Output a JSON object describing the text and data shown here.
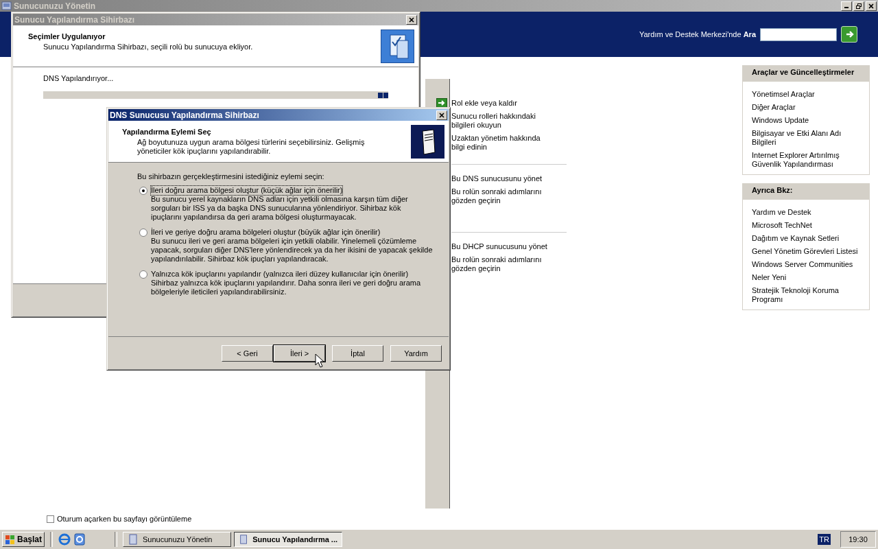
{
  "main_window": {
    "title": "Sunucunuzu Yönetin",
    "active": false,
    "search": {
      "label": "Yardım ve Destek Merkezi'nde **Ara**"
    },
    "role_groups": [
      {
        "links": [
          {
            "text": "Rol ekle veya kaldır",
            "kind": "arrow"
          },
          {
            "text": "Sunucu rolleri hakkındaki bilgileri okuyun",
            "kind": "plain"
          },
          {
            "text": "Uzaktan yönetim hakkında bilgi edinin",
            "kind": "plain"
          }
        ]
      },
      {
        "links": [
          {
            "text": "Bu DNS sunucusunu yönet",
            "kind": "plain"
          },
          {
            "text": "Bu rolün sonraki adımlarını gözden geçirin",
            "kind": "plain"
          }
        ]
      },
      {
        "links": [
          {
            "text": "Bu DHCP sunucusunu yönet",
            "kind": "plain"
          },
          {
            "text": "Bu rolün sonraki adımlarını gözden geçirin",
            "kind": "plain"
          }
        ]
      }
    ],
    "sidebar": [
      {
        "title": "Araçlar ve Güncelleştirmeler",
        "items": [
          "Yönetimsel Araçlar",
          "Diğer Araçlar",
          "Windows Update",
          "Bilgisayar ve Etki Alanı Adı Bilgileri",
          "Internet Explorer Artırılmış Güvenlik Yapılandırması"
        ]
      },
      {
        "title": "Ayrıca Bkz:",
        "items": [
          "Yardım ve Destek",
          "Microsoft TechNet",
          "Dağıtım ve Kaynak Setleri",
          "Genel Yönetim Görevleri Listesi",
          "Windows Server Communities",
          "Neler Yeni",
          "Stratejik Teknoloji Koruma Programı"
        ]
      }
    ],
    "footer_checkbox": {
      "label": "Oturum açarken bu sayfayı görüntüleme",
      "checked": false
    }
  },
  "setup_wizard": {
    "title": "Sunucu Yapılandırma Sihirbazı",
    "active": false,
    "heading": "Seçimler Uygulanıyor",
    "subheading": "Sunucu Yapılandırma Sihirbazı, seçili rolü bu sunucuya ekliyor.",
    "status": "DNS Yapılandırıyor..."
  },
  "dns_wizard": {
    "title": "DNS Sunucusu Yapılandırma Sihirbazı",
    "active": true,
    "heading": "Yapılandırma Eylemi Seç",
    "description": "Ağ boyutunuza uygun arama bölgesi türlerini seçebilirsiniz. Gelişmiş yöneticiler kök ipuçlarını yapılandırabilir.",
    "prompt": "Bu sihirbazın gerçekleştirmesini istediğiniz eylemi seçin:",
    "options": [
      {
        "label": "İleri doğru arama bölgesi oluştur (küçük ağlar için önerilir)",
        "description": "Bu sunucu yerel kaynakların DNS adları için yetkili olmasına karşın tüm diğer sorguları bir ISS ya da başka DNS sunucularına yönlendiriyor. Sihirbaz kök ipuçlarını yapılandırsa da geri arama bölgesi oluşturmayacak.",
        "selected": true
      },
      {
        "label": "İleri ve geriye doğru arama bölgeleri oluştur (büyük ağlar için önerilir)",
        "description": "Bu sunucu ileri ve geri arama bölgeleri için yetkili olabilir. Yinelemeli çözümleme yapacak, sorguları diğer DNS'lere yönlendirecek ya da her ikisini de yapacak şekilde yapılandırılabilir. Sihirbaz kök ipuçları yapılandıracak.",
        "selected": false
      },
      {
        "label": "Yalnızca kök ipuçlarını yapılandır (yalnızca ileri düzey kullanıcılar için önerilir)",
        "description": "Sihirbaz yalnızca kök ipuçlarını yapılandırır. Daha sonra ileri ve geri doğru arama bölgeleriyle ileticileri yapılandırabilirsiniz.",
        "selected": false
      }
    ],
    "buttons": [
      {
        "label": "< Geri",
        "focused": false
      },
      {
        "label": "İleri >",
        "focused": true
      },
      {
        "label": "İptal",
        "focused": false
      },
      {
        "label": "Yardım",
        "focused": false
      }
    ]
  },
  "taskbar": {
    "start": "Başlat",
    "tasks": [
      {
        "label": "Sunucunuzu Yönetin",
        "selected": false
      },
      {
        "label": "Sunucu Yapılandırma ...",
        "selected": true
      }
    ],
    "language": "TR",
    "clock": "19:30"
  }
}
